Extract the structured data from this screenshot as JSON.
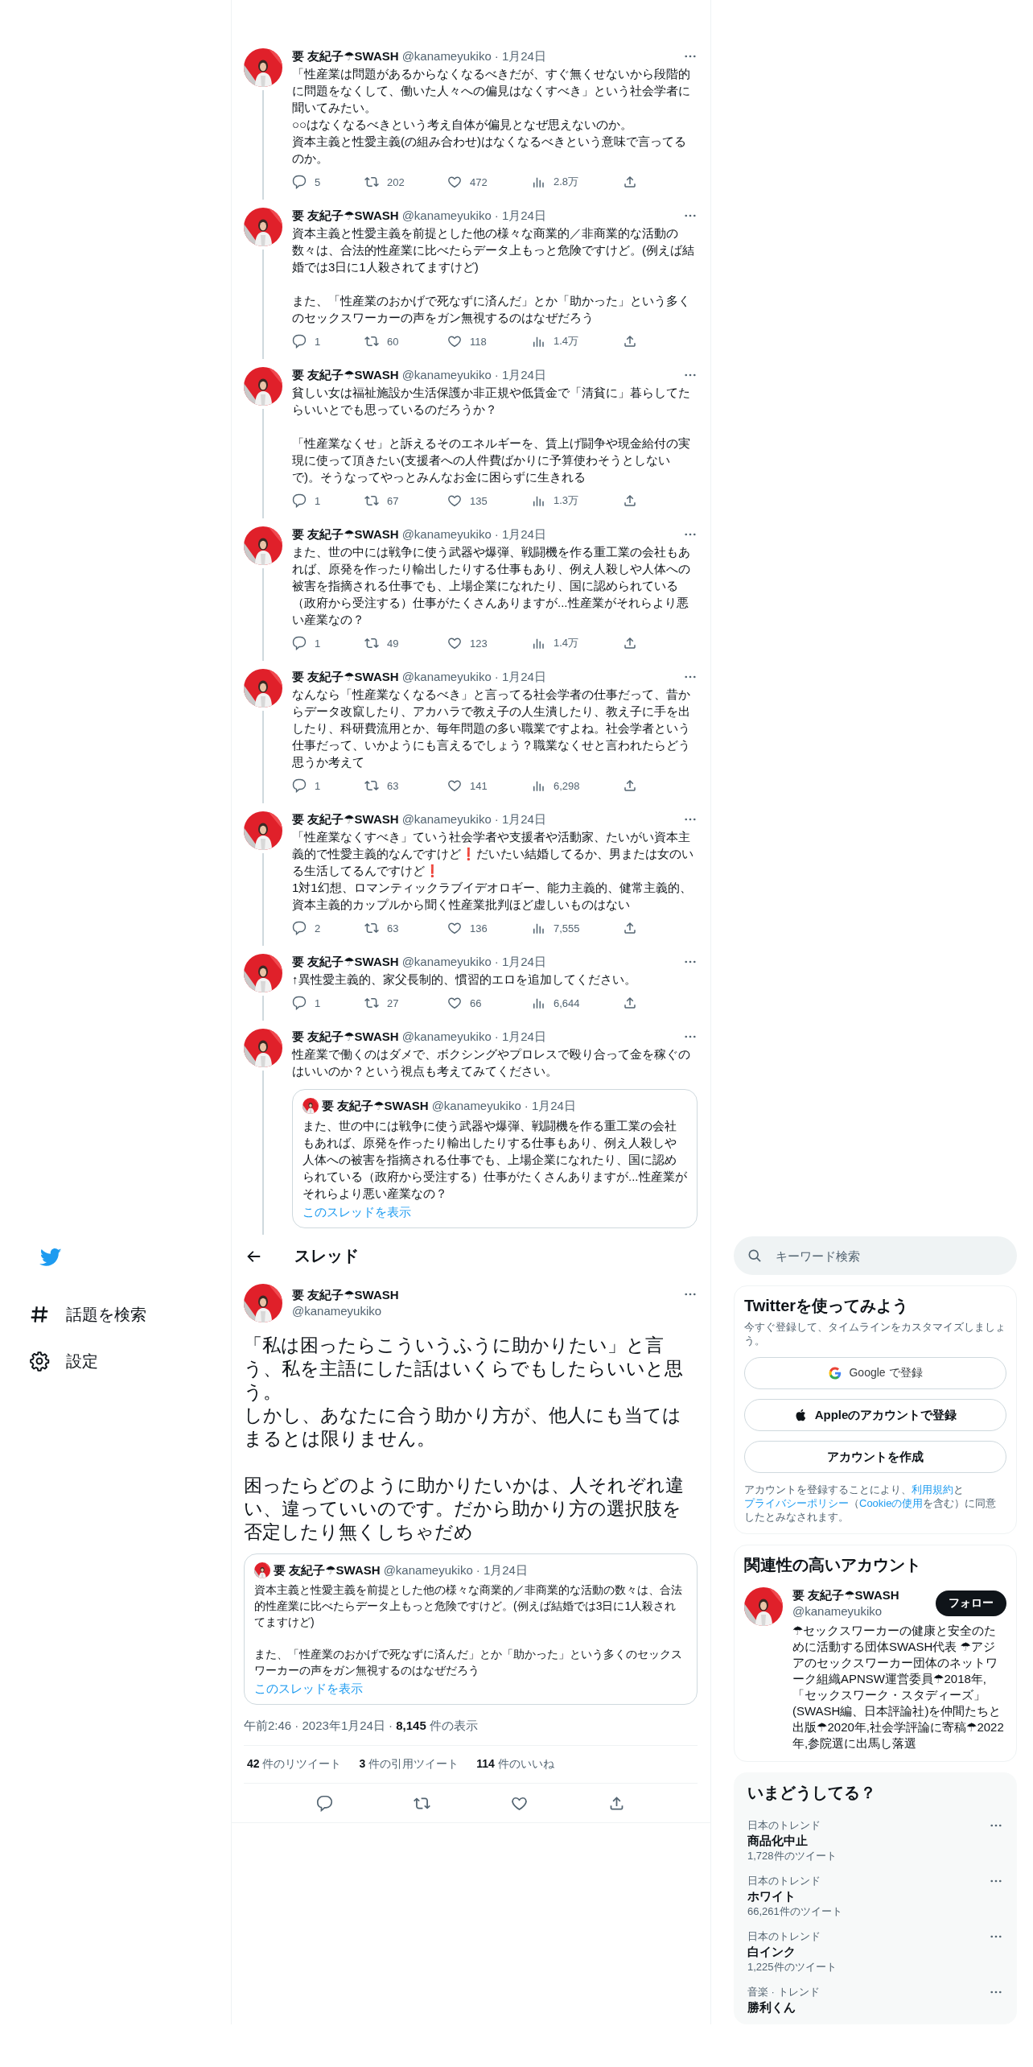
{
  "thread": {
    "tweets": [
      {
        "name": "要 友紀子☂SWASH",
        "handle": "@kanameyukiko",
        "date": "· 1月24日",
        "paragraphs": [
          [
            "「性産業は問題があるからなくなるべきだが、すぐ無くせないから段階的に問題をなくして、働いた人々への偏見はなくすべき」という社会学者に聞いてみたい。",
            "○○はなくなるべきという考え自体が偏見となぜ思えないのか。",
            "資本主義と性愛主義(の組み合わせ)はなくなるべきという意味で言ってるのか。"
          ]
        ],
        "stats": {
          "replies": "5",
          "retweets": "202",
          "likes": "472",
          "views": "2.8万"
        }
      },
      {
        "name": "要 友紀子☂SWASH",
        "handle": "@kanameyukiko",
        "date": "· 1月24日",
        "paragraphs": [
          [
            "資本主義と性愛主義を前提とした他の様々な商業的／非商業的な活動の数々は、合法的性産業に比べたらデータ上もっと危険ですけど。(例えば結婚では3日に1人殺されてますけど)"
          ],
          [
            "また、「性産業のおかげで死なずに済んだ」とか「助かった」という多くのセックスワーカーの声をガン無視するのはなぜだろう"
          ]
        ],
        "stats": {
          "replies": "1",
          "retweets": "60",
          "likes": "118",
          "views": "1.4万"
        }
      },
      {
        "name": "要 友紀子☂SWASH",
        "handle": "@kanameyukiko",
        "date": "· 1月24日",
        "paragraphs": [
          [
            "貧しい女は福祉施設か生活保護か非正規や低賃金で「清貧に」暮らしてたらいいとでも思っているのだろうか？"
          ],
          [
            "「性産業なくせ」と訴えるそのエネルギーを、賃上げ闘争や現金給付の実現に使って頂きたい(支援者への人件費ばかりに予算使わそうとしないで)。そうなってやっとみんなお金に困らずに生きれる"
          ]
        ],
        "stats": {
          "replies": "1",
          "retweets": "67",
          "likes": "135",
          "views": "1.3万"
        }
      },
      {
        "name": "要 友紀子☂SWASH",
        "handle": "@kanameyukiko",
        "date": "· 1月24日",
        "paragraphs": [
          [
            "また、世の中には戦争に使う武器や爆弾、戦闘機を作る重工業の会社もあれば、原発を作ったり輸出したりする仕事もあり、例え人殺しや人体への被害を指摘される仕事でも、上場企業になれたり、国に認められている（政府から受注する）仕事がたくさんありますが...性産業がそれらより悪い産業なの？"
          ]
        ],
        "stats": {
          "replies": "1",
          "retweets": "49",
          "likes": "123",
          "views": "1.4万"
        }
      },
      {
        "name": "要 友紀子☂SWASH",
        "handle": "@kanameyukiko",
        "date": "· 1月24日",
        "paragraphs": [
          [
            "なんなら「性産業なくなるべき」と言ってる社会学者の仕事だって、昔からデータ改竄したり、アカハラで教え子の人生潰したり、教え子に手を出したり、科研費流用とか、毎年問題の多い職業ですよね。社会学者という仕事だって、いかようにも言えるでしょう？職業なくせと言われたらどう思うか考えて"
          ]
        ],
        "stats": {
          "replies": "1",
          "retweets": "63",
          "likes": "141",
          "views": "6,298"
        }
      },
      {
        "name": "要 友紀子☂SWASH",
        "handle": "@kanameyukiko",
        "date": "· 1月24日",
        "paragraphs": [
          [
            "「性産業なくすべき」ていう社会学者や支援者や活動家、たいがい資本主義的で性愛主義的なんですけど❗だいたい結婚してるか、男または女のいる生活してるんですけど❗",
            "1対1幻想、ロマンティックラブイデオロギー、能力主義的、健常主義的、資本主義的カップルから聞く性産業批判ほど虚しいものはない"
          ]
        ],
        "stats": {
          "replies": "2",
          "retweets": "63",
          "likes": "136",
          "views": "7,555"
        }
      },
      {
        "name": "要 友紀子☂SWASH",
        "handle": "@kanameyukiko",
        "date": "· 1月24日",
        "paragraphs": [
          [
            "↑異性愛主義的、家父長制的、慣習的エロを追加してください。"
          ]
        ],
        "stats": {
          "replies": "1",
          "retweets": "27",
          "likes": "66",
          "views": "6,644"
        }
      },
      {
        "name": "要 友紀子☂SWASH",
        "handle": "@kanameyukiko",
        "date": "· 1月24日",
        "paragraphs": [
          [
            "性産業で働くのはダメで、ボクシングやプロレスで殴り合って金を稼ぐのはいいのか？という視点も考えてみてください。"
          ]
        ],
        "quote": {
          "name": "要 友紀子☂SWASH",
          "handle": "@kanameyukiko",
          "date": "· 1月24日",
          "paragraphs": [
            [
              "また、世の中には戦争に使う武器や爆弾、戦闘機を作る重工業の会社もあれば、原発を作ったり輸出したりする仕事もあり、例え人殺しや人体への被害を指摘される仕事でも、上場企業になれたり、国に認められている（政府から受注する）仕事がたくさんありますが...性産業がそれらより悪い産業なの？"
            ]
          ],
          "link": "このスレッドを表示"
        }
      }
    ]
  },
  "nav": {
    "items": [
      {
        "kind": "explore",
        "label": "話題を検索"
      },
      {
        "kind": "settings",
        "label": "設定"
      }
    ]
  },
  "main": {
    "header": {
      "title": "スレッド"
    },
    "tweet": {
      "name": "要 友紀子☂SWASH",
      "handle": "@kanameyukiko",
      "paragraphs": [
        [
          "「私は困ったらこういうふうに助かりたい」と言う、私を主語にした話はいくらでもしたらいいと思う。",
          "しかし、あなたに合う助かり方が、他人にも当てはまるとは限りません。"
        ],
        [
          "困ったらどのように助かりたいかは、人それぞれ違い、違っていいのです。だから助かり方の選択肢を否定したり無くしちゃだめ"
        ]
      ],
      "quote": {
        "name": "要 友紀子☂SWASH",
        "handle": "@kanameyukiko",
        "date": "· 1月24日",
        "paragraphs": [
          [
            "資本主義と性愛主義を前提とした他の様々な商業的／非商業的な活動の数々は、合法的性産業に比べたらデータ上もっと危険ですけど。(例えば結婚では3日に1人殺されてますけど)"
          ],
          [
            "また、「性産業のおかげで死なずに済んだ」とか「助かった」という多くのセックスワーカーの声をガン無視するのはなぜだろう"
          ]
        ],
        "link": "このスレッドを表示"
      },
      "meta": "午前2:46 · 2023年1月24日 · **8,145** 件の表示",
      "counts": [
        "**42** 件のリツイート",
        "**3** 件の引用ツイート",
        "**114** 件のいいね"
      ]
    }
  },
  "sidebar": {
    "search": {
      "placeholder": "キーワード検索"
    },
    "signup": {
      "title": "Twitterを使ってみよう",
      "subtitle": "今すぐ登録して、タイムラインをカスタマイズしましょう。",
      "buttons": [
        {
          "kind": "google",
          "label": "Google で登録"
        },
        {
          "kind": "apple",
          "label": "Appleのアカウントで登録"
        },
        {
          "kind": "plain",
          "label": "アカウントを作成"
        }
      ],
      "legal": [
        {
          "text": "アカウントを登録することにより、",
          "link": false
        },
        {
          "text": "利用規約",
          "link": true
        },
        {
          "text": "と",
          "link": false
        },
        {
          "text": "プライバシーポリシー",
          "link": true
        },
        {
          "text": "（",
          "link": false
        },
        {
          "text": "Cookieの使用",
          "link": true
        },
        {
          "text": "を含む）に同意したとみなされます。",
          "link": false
        }
      ]
    },
    "related": {
      "title": "関連性の高いアカウント",
      "accounts": [
        {
          "name": "要 友紀子☂SWASH",
          "handle": "@kanameyukiko",
          "follow": "フォロー",
          "bio": "☂セックスワーカーの健康と安全のために活動する団体SWASH代表 ☂アジアのセックスワーカー団体のネットワーク組織APNSW運営委員☂2018年,「セックスワーク・スタディーズ」(SWASH編、日本評論社)を仲間たちと出版☂2020年,社会学評論に寄稿☂2022年,参院選に出馬し落選"
        }
      ]
    },
    "trends": {
      "title": "いまどうしてる？",
      "items": [
        {
          "context": "日本のトレンド",
          "topic": "商品化中止",
          "count": "1,728件のツイート"
        },
        {
          "context": "日本のトレンド",
          "topic": "ホワイト",
          "count": "66,261件のツイート"
        },
        {
          "context": "日本のトレンド",
          "topic": "白インク",
          "count": "1,225件のツイート"
        },
        {
          "context": "音楽 · トレンド",
          "topic": "勝利くん"
        }
      ]
    }
  }
}
